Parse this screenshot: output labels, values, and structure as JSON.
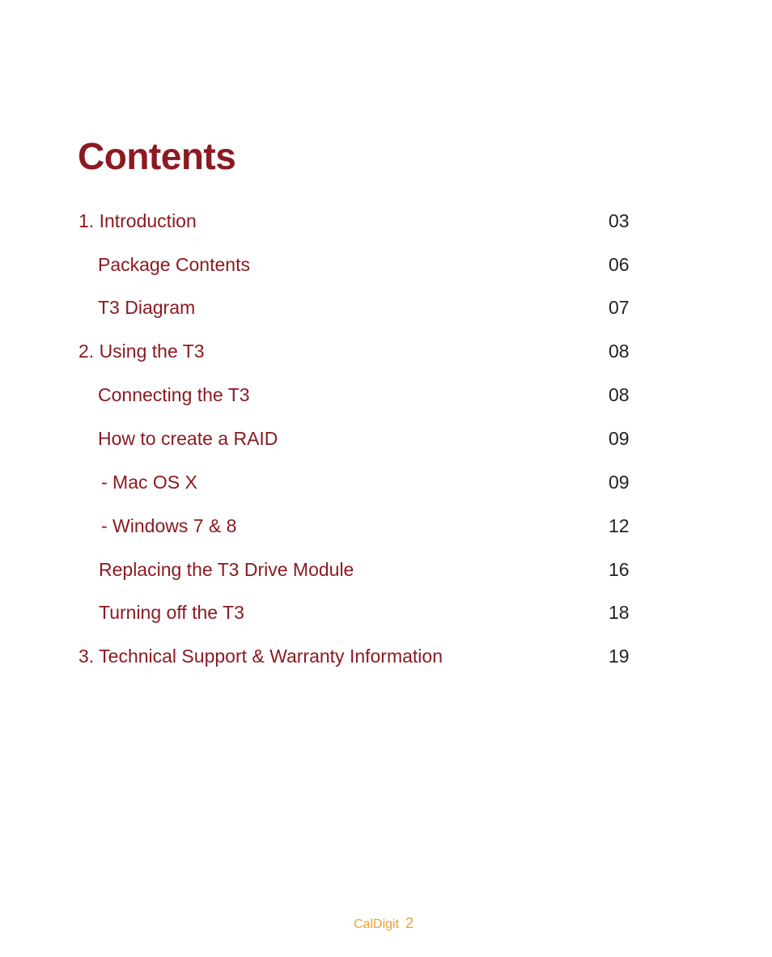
{
  "title": "Contents",
  "toc": [
    {
      "label": "1. Introduction",
      "page": "03",
      "level": 0
    },
    {
      "label": "Package Contents",
      "page": "06",
      "level": 1
    },
    {
      "label": "T3 Diagram",
      "page": "07",
      "level": 1
    },
    {
      "label": "2. Using the T3",
      "page": "08",
      "level": 0
    },
    {
      "label": "Connecting the T3",
      "page": "08",
      "level": 1
    },
    {
      "label": "How to create a RAID",
      "page": "09",
      "level": 1
    },
    {
      "label": "- Mac OS X",
      "page": "09",
      "level": 2
    },
    {
      "label": "- Windows 7 & 8",
      "page": "12",
      "level": 2
    },
    {
      "label": "Replacing the T3 Drive Module",
      "page": "16",
      "level": 1
    },
    {
      "label": "Turning off the T3",
      "page": "18",
      "level": 1
    },
    {
      "label": "3. Technical Support & Warranty Information",
      "page": "19",
      "level": 0
    }
  ],
  "footer": {
    "brand": "CalDigit",
    "page_number": "2"
  },
  "colors": {
    "heading": "#8b1a22",
    "page_numbers": "#222222",
    "footer": "#f0a030"
  }
}
